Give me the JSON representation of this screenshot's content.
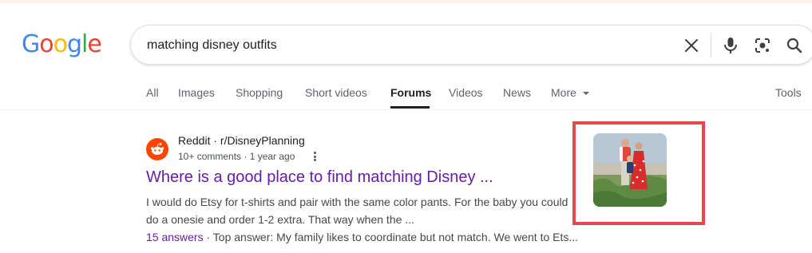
{
  "logo": {
    "letters": [
      "G",
      "o",
      "o",
      "g",
      "l",
      "e"
    ],
    "colors": [
      "#4285f4",
      "#ea4335",
      "#fbbc05",
      "#4285f4",
      "#34a853",
      "#ea4335"
    ]
  },
  "search": {
    "query": "matching disney outfits"
  },
  "tabs": [
    {
      "label": "All",
      "active": false
    },
    {
      "label": "Images",
      "active": false
    },
    {
      "label": "Shopping",
      "active": false
    },
    {
      "label": "Short videos",
      "active": false
    },
    {
      "label": "Forums",
      "active": true
    },
    {
      "label": "Videos",
      "active": false
    },
    {
      "label": "News",
      "active": false
    },
    {
      "label": "More",
      "active": false
    }
  ],
  "tools_label": "Tools",
  "result": {
    "site_name": "Reddit · r/DisneyPlanning",
    "meta": "10+ comments · 1 year ago",
    "title": "Where is a good place to find matching Disney ...",
    "snippet": "I would do Etsy for t-shirts and pair with the same color pants. For the baby you could do a onesie and order 1-2 extra. That way when the ...",
    "answers_link": "15 answers",
    "answers_text": " · Top answer: My family likes to coordinate but not match. We went to Ets..."
  },
  "colors": {
    "highlight": "#e5484d",
    "visited_link": "#681da8",
    "reddit": "#ff4500"
  }
}
